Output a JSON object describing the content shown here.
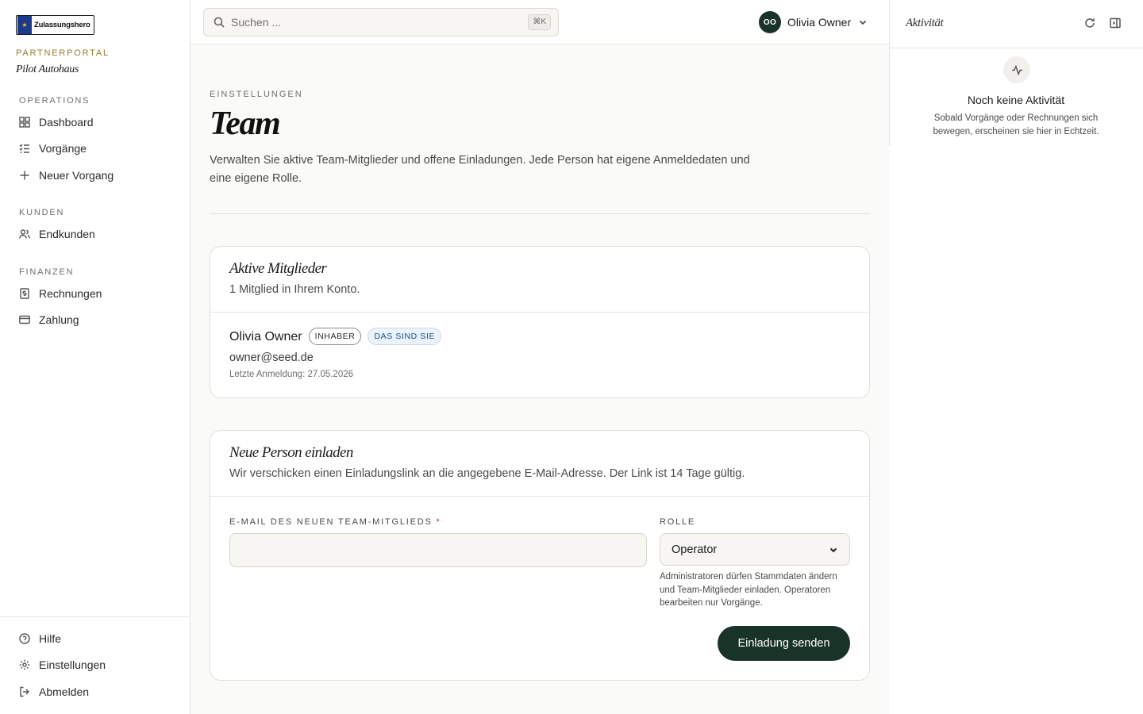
{
  "brand": {
    "logo_text": "Zulassungshero",
    "portal_label": "PARTNERPORTAL",
    "portal_name": "Pilot Autohaus"
  },
  "sidebar": {
    "sections": [
      {
        "label": "OPERATIONS",
        "items": [
          {
            "label": "Dashboard",
            "icon": "grid-icon"
          },
          {
            "label": "Vorgänge",
            "icon": "checklist-icon"
          },
          {
            "label": "Neuer Vorgang",
            "icon": "plus-icon"
          }
        ]
      },
      {
        "label": "KUNDEN",
        "items": [
          {
            "label": "Endkunden",
            "icon": "users-icon"
          }
        ]
      },
      {
        "label": "FINANZEN",
        "items": [
          {
            "label": "Rechnungen",
            "icon": "invoice-icon"
          },
          {
            "label": "Zahlung",
            "icon": "credit-card-icon"
          }
        ]
      }
    ],
    "bottom": [
      {
        "label": "Hilfe",
        "icon": "help-icon"
      },
      {
        "label": "Einstellungen",
        "icon": "gear-icon"
      },
      {
        "label": "Abmelden",
        "icon": "logout-icon"
      }
    ]
  },
  "topbar": {
    "search_placeholder": "Suchen ...",
    "search_shortcut": "⌘K",
    "user": {
      "initials": "OO",
      "name": "Olivia Owner"
    }
  },
  "page": {
    "eyebrow": "EINSTELLUNGEN",
    "title": "Team",
    "description": "Verwalten Sie aktive Team-Mitglieder und offene Einladungen. Jede Person hat eigene Anmeldedaten und eine eigene Rolle."
  },
  "members_card": {
    "title": "Aktive Mitglieder",
    "subtitle": "1 Mitglied in Ihrem Konto.",
    "members": [
      {
        "name": "Olivia Owner",
        "role_badge": "INHABER",
        "self_badge": "DAS SIND SIE",
        "email": "owner@seed.de",
        "last_login": "Letzte Anmeldung: 27.05.2026"
      }
    ]
  },
  "invite_card": {
    "title": "Neue Person einladen",
    "subtitle": "Wir verschicken einen Einladungslink an die angegebene E-Mail-Adresse. Der Link ist 14 Tage gültig.",
    "email_label": "E-MAIL DES NEUEN TEAM-MITGLIEDS",
    "required_mark": "*",
    "email_value": "",
    "role_label": "ROLLE",
    "role_value": "Operator",
    "role_hint": "Administratoren dürfen Stammdaten ändern und Team-Mitglieder einladen. Operatoren bearbeiten nur Vorgänge.",
    "submit_label": "Einladung senden"
  },
  "activity": {
    "title": "Aktivität",
    "empty_title": "Noch keine Aktivität",
    "empty_desc": "Sobald Vorgänge oder Rechnungen sich bewegen, erscheinen sie hier in Echtzeit."
  },
  "colors": {
    "accent": "#1a3329",
    "gold": "#9a7b28",
    "badge_blue": "#1d4f86"
  }
}
